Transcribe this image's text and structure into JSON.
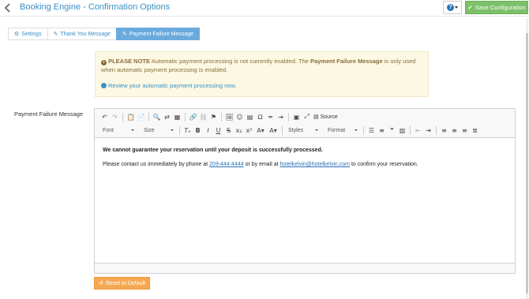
{
  "header": {
    "title": "Booking Engine - Confirmation Options",
    "help_label": "?",
    "save_label": "Save Configuration"
  },
  "tabs": [
    {
      "label": "Settings",
      "icon": "gear-icon",
      "active": false
    },
    {
      "label": "Thank You Message",
      "icon": "edit-icon",
      "active": false
    },
    {
      "label": "Payment Failure Message",
      "icon": "edit-icon",
      "active": true
    }
  ],
  "alert": {
    "note_label": "PLEASE NOTE",
    "text_part1": "Automatic payment processing is not currently enabled. The",
    "highlight": "Payment Failure Message",
    "text_part2": "is only used when automatic payment processing is enabled.",
    "link_text": "Review your automatic payment processing now."
  },
  "field": {
    "label": "Payment Failure Message"
  },
  "editor": {
    "source_label": "Source",
    "font_label": "Font",
    "size_label": "Size",
    "styles_label": "Styles",
    "format_label": "Format",
    "content": {
      "heading": "We cannot guarantee your reservation until your deposit is successfully processed.",
      "line_prefix": "Please contact us immediately by phone at",
      "phone": "209-444-4444",
      "line_mid": "or by email at",
      "email": "hotelkelvin@hotelkelvin.com",
      "line_suffix": "to confirm your reservation."
    }
  },
  "reset_label": "Reset to Default",
  "colors": {
    "accent": "#3a8fc6",
    "save_green": "#7cc06a",
    "reset_orange": "#f5a853",
    "alert_bg": "#fcf8e3",
    "tab_active": "#6aaadd"
  }
}
